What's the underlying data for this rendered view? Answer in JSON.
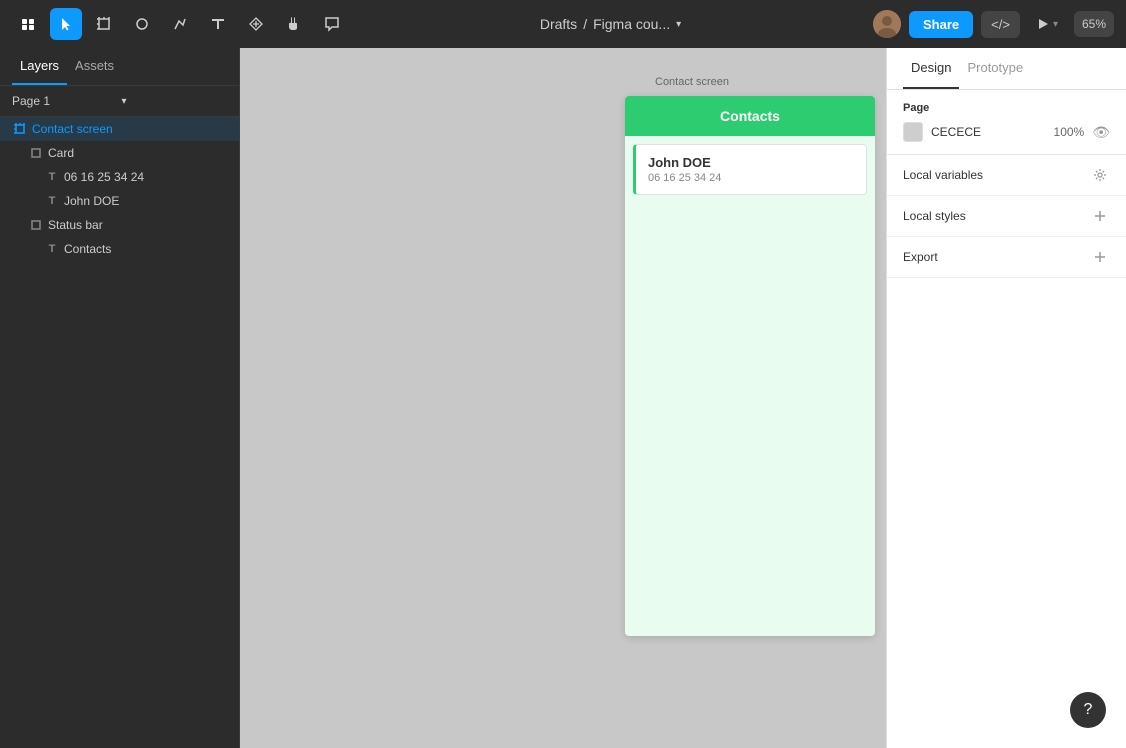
{
  "toolbar": {
    "breadcrumb_drafts": "Drafts",
    "breadcrumb_sep": "/",
    "breadcrumb_file": "Figma cou...",
    "share_label": "Share",
    "code_label": "</>",
    "zoom_label": "65%"
  },
  "sidebar": {
    "tab_layers": "Layers",
    "tab_assets": "Assets",
    "page_label": "Page 1",
    "layers": [
      {
        "id": "contact-screen",
        "label": "Contact screen",
        "icon": "frame",
        "indent": 0
      },
      {
        "id": "card",
        "label": "Card",
        "icon": "frame",
        "indent": 1
      },
      {
        "id": "phone-text",
        "label": "06 16 25 34 24",
        "icon": "text",
        "indent": 2
      },
      {
        "id": "name-text",
        "label": "John DOE",
        "icon": "text",
        "indent": 2
      },
      {
        "id": "status-bar",
        "label": "Status bar",
        "icon": "frame",
        "indent": 1
      },
      {
        "id": "contacts-text",
        "label": "Contacts",
        "icon": "text",
        "indent": 2
      }
    ]
  },
  "canvas": {
    "frame_label": "Contact screen",
    "phone": {
      "header_text": "Contacts",
      "card_name": "John DOE",
      "card_phone": "06 16 25 34 24"
    }
  },
  "right_panel": {
    "tab_design": "Design",
    "tab_prototype": "Prototype",
    "page_section_title": "Page",
    "page_color": "CECECE",
    "page_opacity": "100%",
    "local_variables_label": "Local variables",
    "local_styles_label": "Local styles",
    "export_label": "Export"
  }
}
